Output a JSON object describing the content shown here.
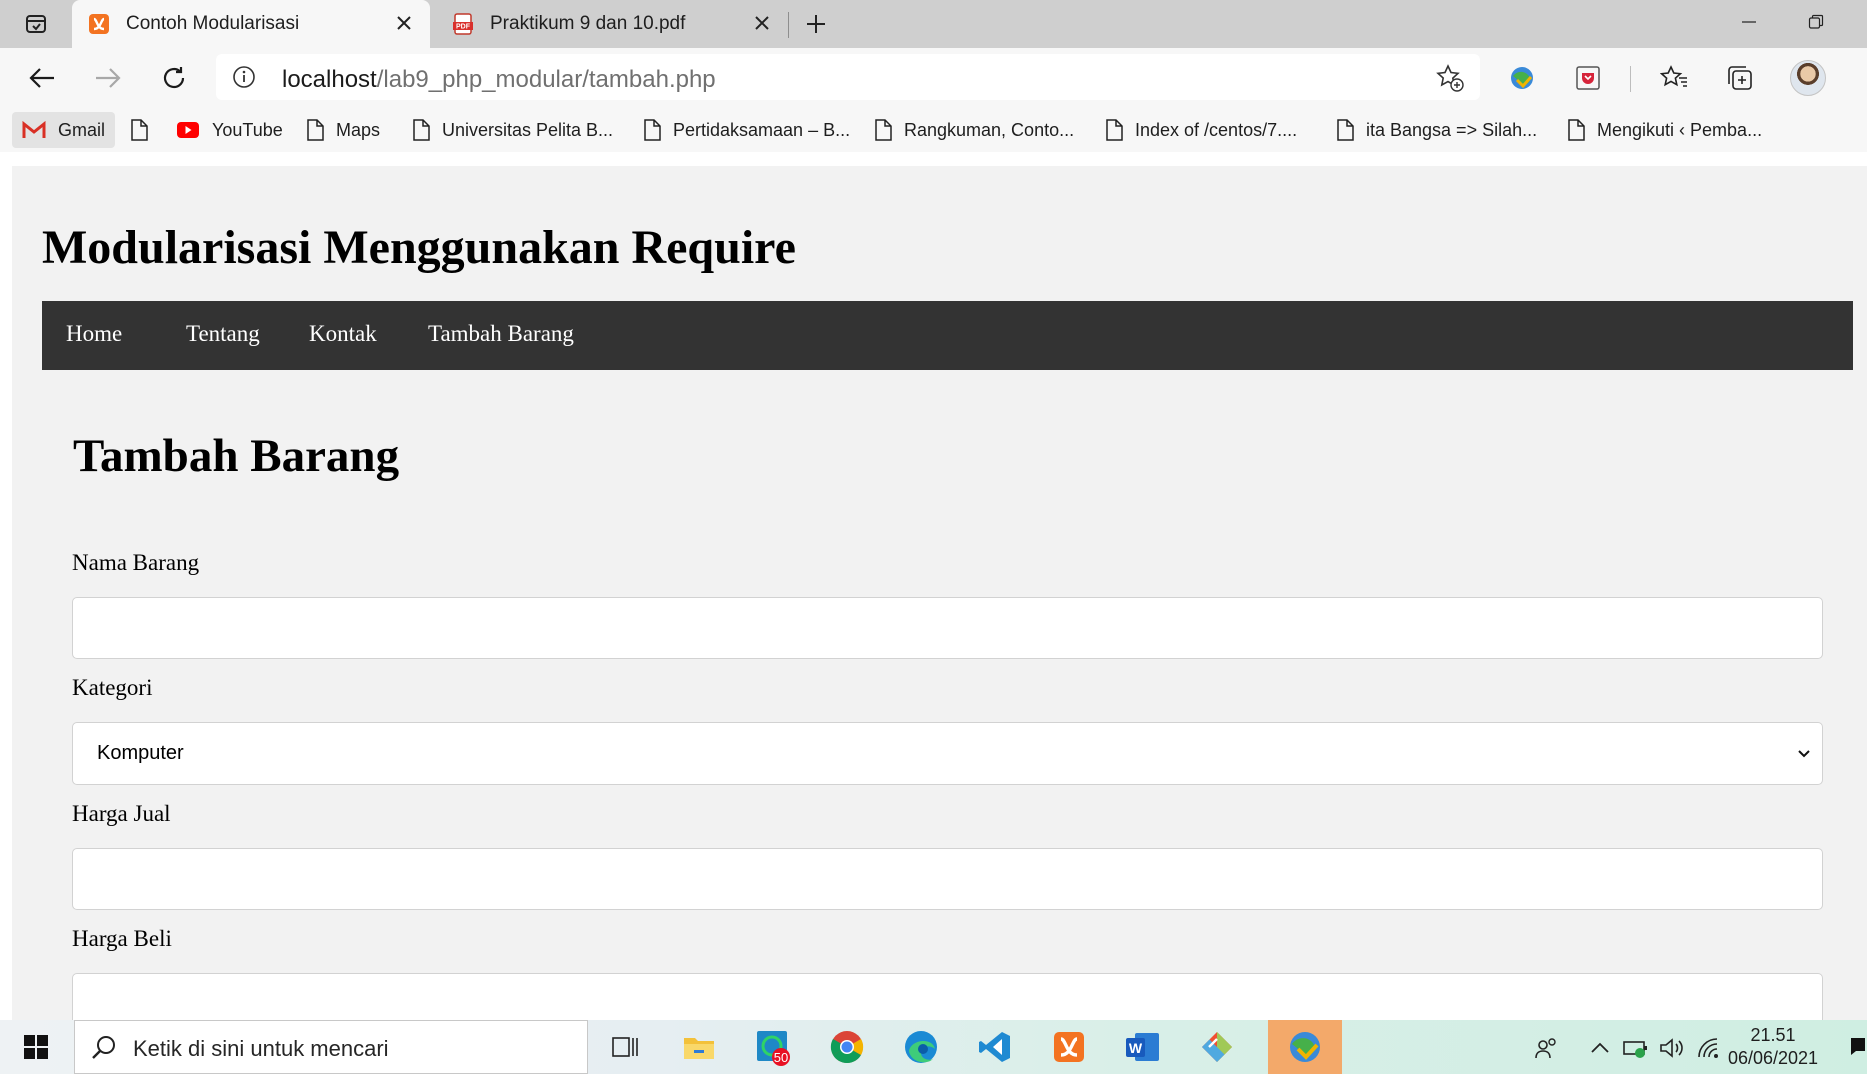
{
  "browser": {
    "tabs": [
      {
        "title": "Contoh Modularisasi",
        "active": true,
        "favicon": "xampp-icon"
      },
      {
        "title": "Praktikum 9 dan 10.pdf",
        "active": false,
        "favicon": "pdf-icon"
      }
    ],
    "address": {
      "host": "localhost",
      "path": "/lab9_php_modular/tambah.php"
    },
    "bookmarks": [
      {
        "label": "Gmail",
        "icon": "gmail-icon"
      },
      {
        "label": "",
        "icon": "page-icon"
      },
      {
        "label": "YouTube",
        "icon": "youtube-icon"
      },
      {
        "label": "Maps",
        "icon": "page-icon"
      },
      {
        "label": "Universitas Pelita B...",
        "icon": "page-icon"
      },
      {
        "label": "Pertidaksamaan – B...",
        "icon": "page-icon"
      },
      {
        "label": "Rangkuman, Conto...",
        "icon": "page-icon"
      },
      {
        "label": "Index of /centos/7....",
        "icon": "page-icon"
      },
      {
        "label": "ita Bangsa => Silah...",
        "icon": "page-icon"
      },
      {
        "label": "Mengikuti ‹ Pemba...",
        "icon": "page-icon"
      }
    ]
  },
  "page": {
    "site_title": "Modularisasi Menggunakan Require",
    "nav": [
      "Home",
      "Tentang",
      "Kontak",
      "Tambah Barang"
    ],
    "content_title": "Tambah Barang",
    "form": {
      "nama_label": "Nama Barang",
      "nama_value": "",
      "kategori_label": "Kategori",
      "kategori_value": "Komputer",
      "harga_jual_label": "Harga Jual",
      "harga_jual_value": "",
      "harga_beli_label": "Harga Beli",
      "harga_beli_value": ""
    }
  },
  "taskbar": {
    "search_placeholder": "Ketik di sini untuk mencari",
    "apps": [
      "task-view-icon",
      "file-explorer-icon",
      "whatsapp-icon",
      "chrome-icon",
      "edge-icon",
      "vscode-icon",
      "xampp-icon",
      "word-icon",
      "git-icon",
      "idm-icon"
    ],
    "whatsapp_badge": "50",
    "time": "21.51",
    "date": "06/06/2021"
  },
  "colors": {
    "navbar": "#333333",
    "page_bg": "#f2f2f2",
    "taskbar_active": "#f3a96a"
  }
}
